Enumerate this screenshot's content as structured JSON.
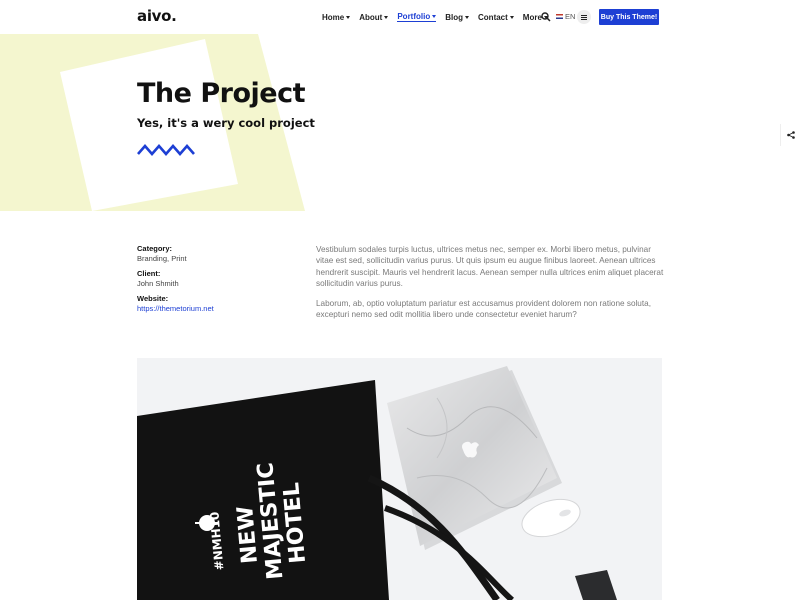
{
  "header": {
    "logo": "aivo.",
    "nav": [
      {
        "label": "Home",
        "active": false
      },
      {
        "label": "About",
        "active": false
      },
      {
        "label": "Portfolio",
        "active": true
      },
      {
        "label": "Blog",
        "active": false
      },
      {
        "label": "Contact",
        "active": false
      },
      {
        "label": "More",
        "active": false
      }
    ],
    "language": "EN",
    "buy_button": "Buy This Theme!"
  },
  "hero": {
    "title": "The Project",
    "subtitle": "Yes, it's a wery cool project"
  },
  "details": {
    "category_label": "Category:",
    "category_value": "Branding, Print",
    "client_label": "Client:",
    "client_value": "John Shmith",
    "website_label": "Website:",
    "website_value": "https://themetorium.net"
  },
  "description": {
    "paragraph1": "Vestibulum sodales turpis luctus, ultrices metus nec, semper ex. Morbi libero metus, pulvinar vitae est sed, sollicitudin varius purus. Ut quis ipsum eu augue finibus laoreet. Aenean ultrices hendrerit suscipit. Mauris vel hendrerit lacus. Aenean semper nulla ultrices enim aliquet placerat sollicitudin varius purus.",
    "paragraph2": "Laborum, ab, optio voluptatum pariatur est accusamus provident dolorem non ratione soluta, excepturi nemo sed odit mollitia libero unde consectetur eveniet harum?"
  },
  "photo": {
    "bag_text_line1": "NEW",
    "bag_text_line2": "MAJESTIC",
    "bag_text_line3": "HOTEL",
    "bag_hashtag": "#NMH10"
  },
  "colors": {
    "accent": "#1d3fd4",
    "hero_shape": "#f4f6cf"
  }
}
